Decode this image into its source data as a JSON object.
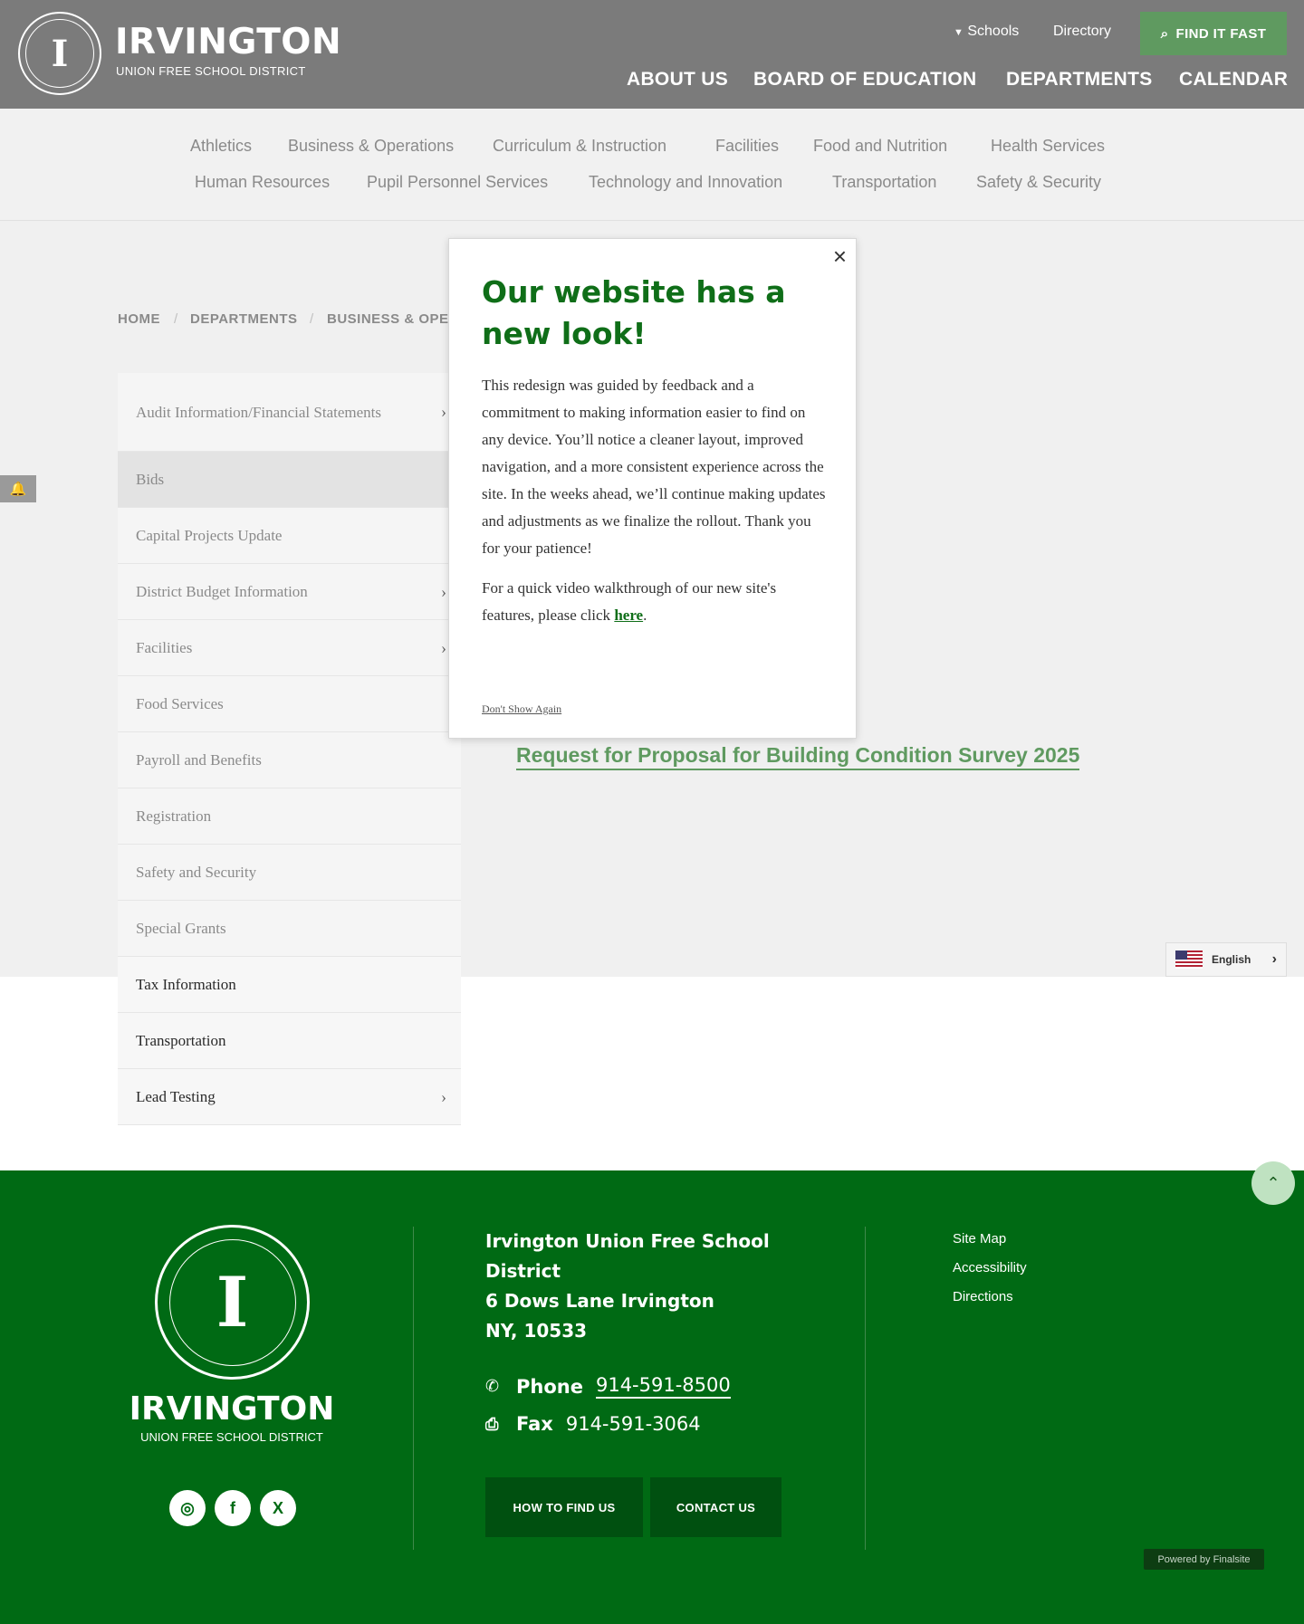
{
  "header": {
    "brand_name": "IRVINGTON",
    "brand_sub": "UNION FREE SCHOOL DISTRICT",
    "schools_label": "Schools",
    "directory_label": "Directory",
    "find_it_fast": "FIND IT FAST",
    "main_nav": [
      "ABOUT US",
      "BOARD OF EDUCATION",
      "DEPARTMENTS",
      "CALENDAR"
    ]
  },
  "subnav": {
    "row1": [
      "Athletics",
      "Business & Operations",
      "Curriculum & Instruction",
      "Facilities",
      "Food and Nutrition",
      "Health Services"
    ],
    "row2": [
      "Human Resources",
      "Pupil Personnel Services",
      "Technology and Innovation",
      "Transportation",
      "Safety & Security"
    ]
  },
  "breadcrumb": [
    "HOME",
    "DEPARTMENTS",
    "BUSINESS & OPER"
  ],
  "sidenav": {
    "items": [
      {
        "label": "Audit Information/Financial Statements",
        "chevron": true
      },
      {
        "label": "Bids",
        "chevron": false
      },
      {
        "label": "Capital Projects Update",
        "chevron": false
      },
      {
        "label": "District Budget Information",
        "chevron": true
      },
      {
        "label": "Facilities",
        "chevron": true
      },
      {
        "label": "Food Services",
        "chevron": false
      },
      {
        "label": "Payroll and Benefits",
        "chevron": false
      },
      {
        "label": "Registration",
        "chevron": false
      },
      {
        "label": "Safety and Security",
        "chevron": false
      },
      {
        "label": "Special Grants",
        "chevron": false
      },
      {
        "label": "Tax Information",
        "chevron": false
      },
      {
        "label": "Transportation",
        "chevron": false
      },
      {
        "label": "Lead Testing",
        "chevron": true
      }
    ]
  },
  "main": {
    "rfp_link": "Request for Proposal for Building Condition Survey 2025"
  },
  "modal": {
    "title": "Our website has a new look!",
    "body1": "This redesign was guided by feedback and a commitment to making information easier to find on any device. You’ll notice a cleaner layout, improved navigation, and a more consistent experience across the site. In the weeks ahead, we’ll continue making updates and adjustments as we finalize the rollout. Thank you for your patience!",
    "body2_prefix": "For a quick video walkthrough of our new site's features, please click ",
    "body2_link": "here",
    "body2_suffix": ".",
    "dont_show": "Don't Show Again",
    "close_glyph": "×"
  },
  "language": {
    "label": "English"
  },
  "footer": {
    "brand_name": "IRVINGTON",
    "brand_sub": "UNION FREE SCHOOL DISTRICT",
    "address_line1": "Irvington Union Free School District",
    "address_line2": "6 Dows Lane Irvington",
    "address_line3": "NY, 10533",
    "phone_label": "Phone",
    "phone_value": "914-591-8500",
    "fax_label": "Fax",
    "fax_value": "914-591-3064",
    "btn_find": "HOW TO FIND US",
    "btn_contact": "CONTACT US",
    "links": [
      "Site Map",
      "Accessibility",
      "Directions"
    ],
    "powered": "Powered by Finalsite"
  },
  "colors": {
    "brand_green": "#006a14",
    "accent_green": "#5f9a60",
    "header_gray": "#7b7b7b"
  }
}
